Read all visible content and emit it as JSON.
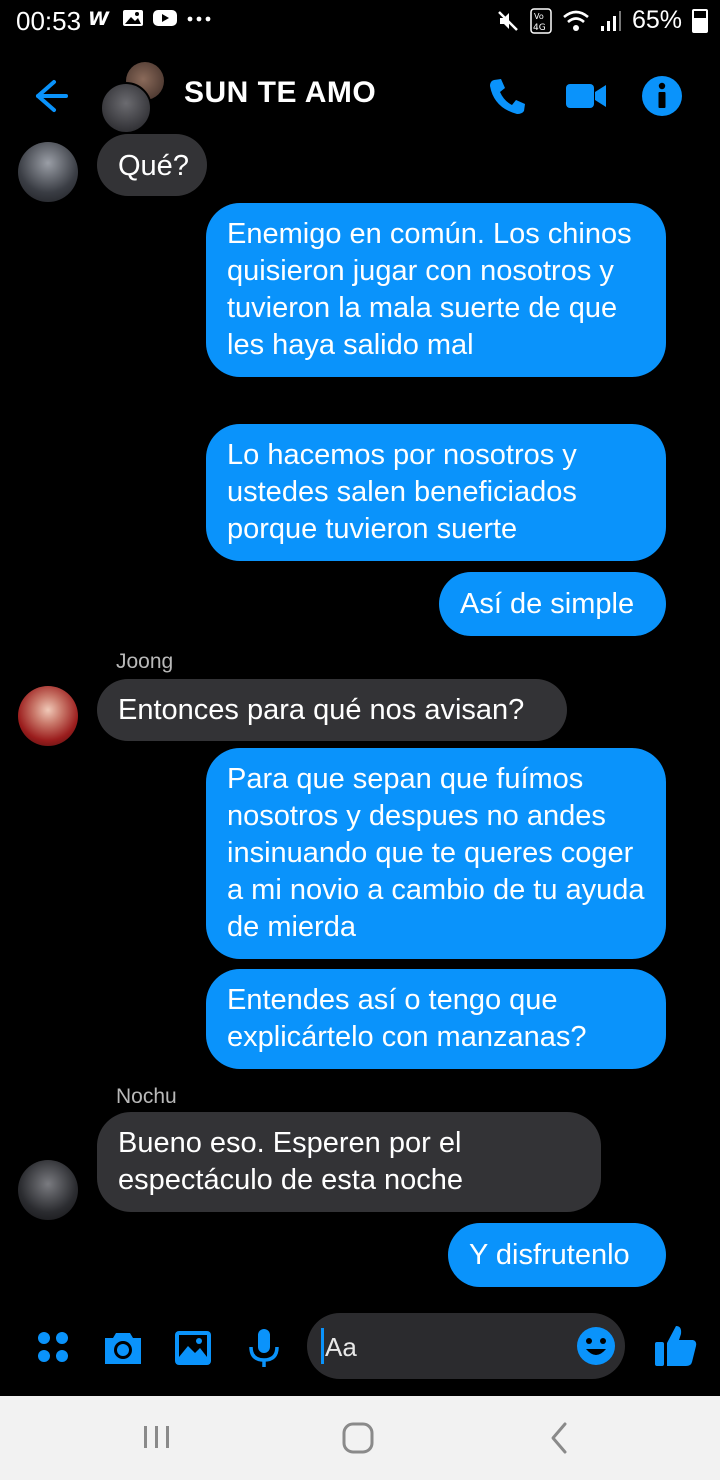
{
  "status_bar": {
    "time": "00:53",
    "left_icons": [
      "whatsapp-icon",
      "gallery-icon",
      "youtube-icon",
      "more-dots-icon"
    ],
    "battery": "65%",
    "right_icons": [
      "mute-icon",
      "volte-icon",
      "wifi-icon",
      "signal-icon",
      "battery-icon"
    ]
  },
  "header": {
    "title": "SUN TE AMO",
    "icons": [
      "back-arrow-icon",
      "phone-icon",
      "video-camera-icon",
      "info-icon"
    ],
    "accent": "#0a93fb"
  },
  "messages": [
    {
      "id": "m1",
      "direction": "in",
      "text": "Qué?"
    },
    {
      "id": "m2",
      "direction": "out",
      "text": "Enemigo en común. Los chinos quisieron jugar con nosotros y tuvieron la mala suerte de que les haya salido mal"
    },
    {
      "id": "m3",
      "direction": "out",
      "text": "Lo hacemos por nosotros y ustedes salen beneficiados porque tuvieron suerte"
    },
    {
      "id": "m4",
      "direction": "out",
      "text": "Así de simple"
    },
    {
      "id": "m5",
      "direction": "in",
      "sender": "Joong",
      "text": "Entonces para qué nos avisan?"
    },
    {
      "id": "m6",
      "direction": "out",
      "text": "Para que sepan que fuímos nosotros y despues no andes insinuando que te queres coger a mi novio a cambio de tu ayuda de mierda"
    },
    {
      "id": "m7",
      "direction": "out",
      "text": "Entendes así o tengo que explicártelo con manzanas?"
    },
    {
      "id": "m8",
      "direction": "in",
      "sender": "Nochu",
      "text": "Bueno eso. Esperen por el espectáculo de esta noche"
    },
    {
      "id": "m9",
      "direction": "out",
      "text": "Y disfrutenlo"
    }
  ],
  "composer": {
    "placeholder": "Aa",
    "icons": [
      "apps-grid-icon",
      "camera-icon",
      "image-icon",
      "microphone-icon",
      "emoji-icon",
      "thumbs-up-icon"
    ]
  },
  "colors": {
    "outgoing_bubble": "#0a93fb",
    "incoming_bubble": "#333336",
    "background": "#000000"
  },
  "nav_bar": {
    "icons": [
      "recent-apps-icon",
      "home-icon",
      "back-icon"
    ]
  }
}
